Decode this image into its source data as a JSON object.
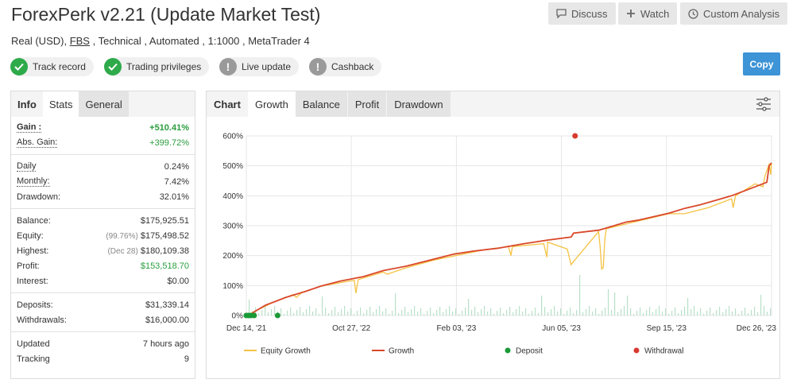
{
  "header": {
    "title": "ForexPerk v2.21 (Update Market Test)",
    "subtitle": {
      "account_type": "Real (USD), ",
      "broker": "FBS",
      "details": " , Technical , Automated , 1:1000 , MetaTrader 4"
    },
    "buttons": {
      "discuss": "Discuss",
      "watch": "Watch",
      "custom_analysis": "Custom Analysis",
      "copy": "Copy"
    }
  },
  "badges": [
    {
      "label": "Track record",
      "status": "ok"
    },
    {
      "label": "Trading privileges",
      "status": "ok"
    },
    {
      "label": "Live update",
      "status": "warn"
    },
    {
      "label": "Cashback",
      "status": "warn"
    }
  ],
  "left_tabs": [
    "Info",
    "Stats",
    "General"
  ],
  "stats": {
    "gain": {
      "label": "Gain :",
      "value": "+510.41%"
    },
    "abs_gain": {
      "label": "Abs. Gain:",
      "value": "+399.72%"
    },
    "daily": {
      "label": "Daily",
      "value": "0.24%"
    },
    "monthly": {
      "label": "Monthly:",
      "value": "7.42%"
    },
    "drawdown": {
      "label": "Drawdown:",
      "value": "32.01%"
    },
    "balance": {
      "label": "Balance:",
      "value": "$175,925.51"
    },
    "equity": {
      "label": "Equity:",
      "pre": "(99.76%)",
      "value": "$175,498.52"
    },
    "highest": {
      "label": "Highest:",
      "pre": "(Dec 28)",
      "value": "$180,109.38"
    },
    "profit": {
      "label": "Profit:",
      "value": "$153,518.70"
    },
    "interest": {
      "label": "Interest:",
      "value": "$0.00"
    },
    "deposits": {
      "label": "Deposits:",
      "value": "$31,339.14"
    },
    "withdrawals": {
      "label": "Withdrawals:",
      "value": "$16,000.00"
    },
    "updated": {
      "label": "Updated",
      "value": "7 hours ago"
    },
    "tracking": {
      "label": "Tracking",
      "value": "9"
    }
  },
  "chart_tabs": [
    "Chart",
    "Growth",
    "Balance",
    "Profit",
    "Drawdown"
  ],
  "colors": {
    "equity": "#f5c242",
    "growth": "#d9482b",
    "deposit": "#1a9a36",
    "withdrawal": "#d83a30",
    "volume": "#b8e0c8",
    "accent": "#3d94d6"
  },
  "chart_data": {
    "type": "line",
    "y_ticks": [
      "0%",
      "100%",
      "200%",
      "300%",
      "400%",
      "500%",
      "600%"
    ],
    "ylim": [
      0,
      600
    ],
    "x_ticks": [
      "Dec 14, '21",
      "Oct 27, '22",
      "Feb 03, '23",
      "Jun 05, '23",
      "Sep 15, '23",
      "Dec 26, '23"
    ],
    "grid": true,
    "legend_position": "bottom",
    "series": [
      {
        "name": "Growth",
        "points": [
          [
            0,
            0
          ],
          [
            3,
            2
          ],
          [
            8,
            8
          ],
          [
            12,
            15
          ],
          [
            15,
            20
          ],
          [
            25,
            35
          ],
          [
            35,
            45
          ],
          [
            50,
            60
          ],
          [
            75,
            80
          ],
          [
            95,
            98
          ],
          [
            120,
            115
          ],
          [
            150,
            130
          ],
          [
            175,
            150
          ],
          [
            205,
            165
          ],
          [
            235,
            185
          ],
          [
            265,
            205
          ],
          [
            290,
            215
          ],
          [
            322,
            225
          ],
          [
            355,
            240
          ],
          [
            385,
            252
          ],
          [
            415,
            262
          ],
          [
            418,
            275
          ],
          [
            450,
            285
          ],
          [
            470,
            300
          ],
          [
            485,
            312
          ],
          [
            500,
            318
          ],
          [
            520,
            330
          ],
          [
            540,
            342
          ],
          [
            560,
            358
          ],
          [
            580,
            370
          ],
          [
            600,
            385
          ],
          [
            620,
            400
          ],
          [
            640,
            420
          ],
          [
            655,
            435
          ],
          [
            665,
            445
          ],
          [
            668,
            500
          ],
          [
            671,
            510
          ]
        ]
      },
      {
        "name": "Equity Growth",
        "points": [
          [
            0,
            0
          ],
          [
            35,
            45
          ],
          [
            60,
            70
          ],
          [
            64,
            60
          ],
          [
            70,
            75
          ],
          [
            95,
            98
          ],
          [
            138,
            118
          ],
          [
            140,
            75
          ],
          [
            143,
            120
          ],
          [
            175,
            145
          ],
          [
            180,
            138
          ],
          [
            205,
            160
          ],
          [
            240,
            185
          ],
          [
            305,
            220
          ],
          [
            335,
            230
          ],
          [
            338,
            200
          ],
          [
            340,
            230
          ],
          [
            380,
            240
          ],
          [
            384,
            195
          ],
          [
            385,
            245
          ],
          [
            410,
            222
          ],
          [
            415,
            170
          ],
          [
            418,
            180
          ],
          [
            450,
            280
          ],
          [
            452,
            230
          ],
          [
            454,
            155
          ],
          [
            456,
            160
          ],
          [
            458,
            255
          ],
          [
            460,
            290
          ],
          [
            540,
            340
          ],
          [
            560,
            340
          ],
          [
            590,
            360
          ],
          [
            620,
            390
          ],
          [
            622,
            360
          ],
          [
            625,
            400
          ],
          [
            650,
            440
          ],
          [
            660,
            430
          ],
          [
            663,
            470
          ],
          [
            668,
            505
          ],
          [
            670,
            470
          ],
          [
            671,
            510
          ]
        ]
      }
    ],
    "deposits": [
      [
        0,
        0
      ],
      [
        3,
        0
      ],
      [
        6,
        0
      ],
      [
        10,
        0
      ],
      [
        40,
        0
      ]
    ],
    "withdrawals": [
      [
        420,
        600
      ]
    ]
  }
}
